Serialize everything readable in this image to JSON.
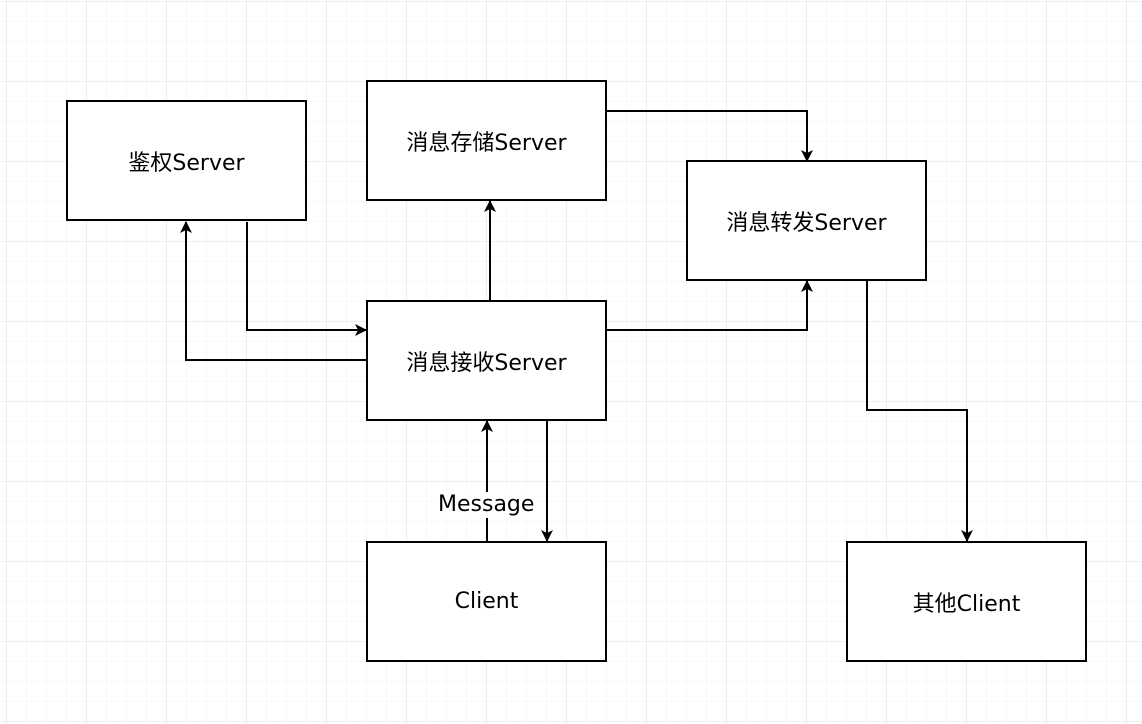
{
  "diagram": {
    "nodes": {
      "auth": {
        "label": "鉴权Server"
      },
      "storage": {
        "label": "消息存储Server"
      },
      "forward": {
        "label": "消息转发Server"
      },
      "receive": {
        "label": "消息接收Server"
      },
      "client": {
        "label": "Client"
      },
      "other_client": {
        "label": "其他Client"
      }
    },
    "edges": [
      {
        "from": "auth",
        "to": "receive"
      },
      {
        "from": "receive",
        "to": "auth"
      },
      {
        "from": "receive",
        "to": "storage"
      },
      {
        "from": "storage",
        "to": "forward"
      },
      {
        "from": "receive",
        "to": "forward"
      },
      {
        "from": "forward",
        "to": "other_client"
      },
      {
        "from": "client",
        "to": "receive",
        "label": "Message"
      },
      {
        "from": "receive",
        "to": "client"
      }
    ],
    "colors": {
      "stroke": "#000000",
      "fill": "#ffffff",
      "grid": "#eeeeee"
    }
  }
}
